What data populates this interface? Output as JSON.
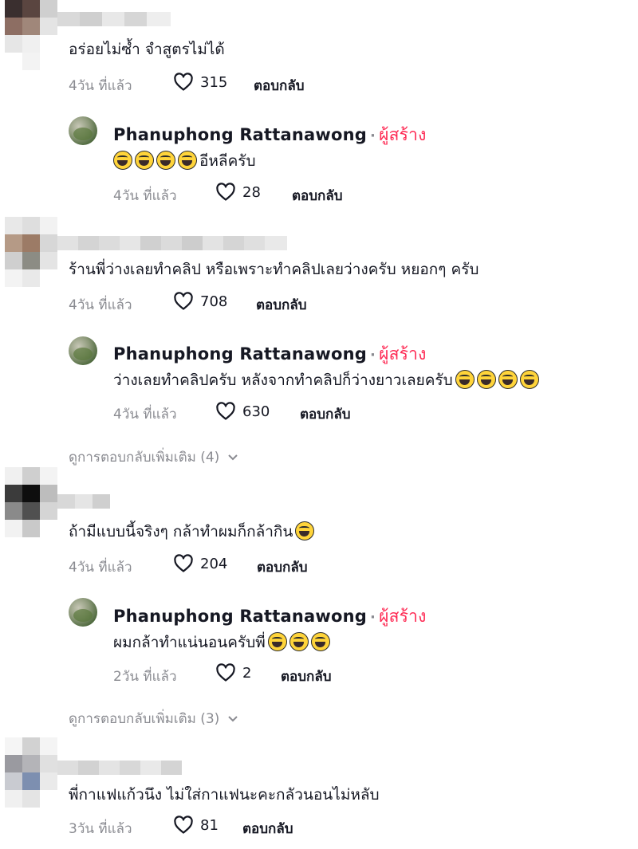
{
  "threads": [
    {
      "comment": {
        "text": "อร่อยไม่ซ้ำ จำสูตรไม่ได้",
        "age": "4วัน ที่แล้ว",
        "likes": "315",
        "reply": "ตอบกลับ"
      },
      "reply": {
        "author": "Phanuphong Rattanawong",
        "separator": "·",
        "badge": "ผู้สร้าง",
        "text": "อีหลีครับ",
        "emoji_count": 4,
        "age": "4วัน ที่แล้ว",
        "likes": "28",
        "reply": "ตอบกลับ"
      },
      "more_replies": ""
    },
    {
      "comment": {
        "text": "ร้านพี่ว่างเลยทำคลิป หรือเพราะทำคลิปเลยว่างครับ หยอกๆ ครับ",
        "age": "4วัน ที่แล้ว",
        "likes": "708",
        "reply": "ตอบกลับ"
      },
      "reply": {
        "author": "Phanuphong Rattanawong",
        "separator": "·",
        "badge": "ผู้สร้าง",
        "text": "ว่างเลยทำคลิปครับ หลังจากทำคลิปก็ว่างยาวเลยครับ",
        "emoji_count": 4,
        "age": "4วัน ที่แล้ว",
        "likes": "630",
        "reply": "ตอบกลับ"
      },
      "more_replies": "ดูการตอบกลับเพิ่มเติม (4)"
    },
    {
      "comment": {
        "text": "ถ้ามีแบบนี้จริงๆ กล้าทำผมก็กล้ากิน",
        "emoji_count": 1,
        "age": "4วัน ที่แล้ว",
        "likes": "204",
        "reply": "ตอบกลับ"
      },
      "reply": {
        "author": "Phanuphong Rattanawong",
        "separator": "·",
        "badge": "ผู้สร้าง",
        "text": "ผมกล้าทำแน่นอนครับพี่",
        "emoji_count": 3,
        "age": "2วัน ที่แล้ว",
        "likes": "2",
        "reply": "ตอบกลับ"
      },
      "more_replies": "ดูการตอบกลับเพิ่มเติม (3)"
    },
    {
      "comment": {
        "text": "พี่กาแฟแก้วนึง ไม่ใส่กาแฟนะคะกลัวนอนไม่หลับ",
        "age": "3วัน ที่แล้ว",
        "likes": "81",
        "reply": "ตอบกลับ"
      }
    }
  ],
  "icons": {
    "like": "heart-outline-icon",
    "expand": "chevron-down-icon",
    "emoji": "grinning-sweat-emoji"
  },
  "colors": {
    "creator_badge": "#fe2c55",
    "meta_text": "#8a8b91",
    "primary_text": "#161823"
  }
}
